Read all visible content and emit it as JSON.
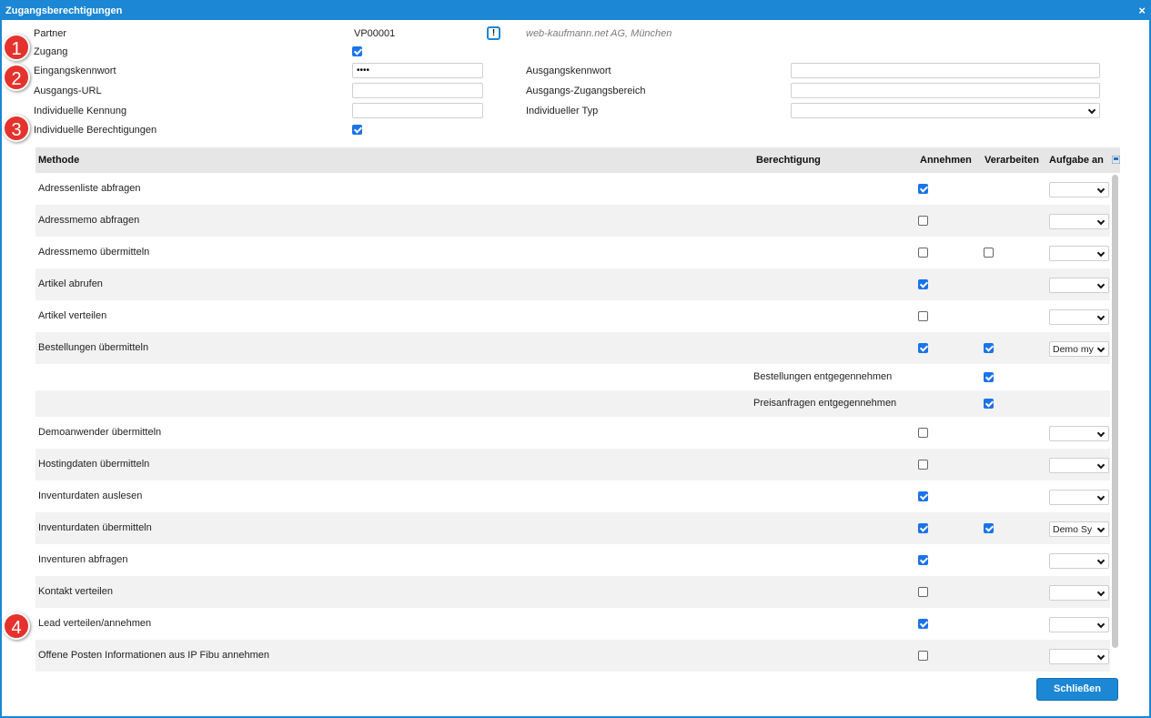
{
  "dialog": {
    "title": "Zugangsberechtigungen",
    "close_glyph": "×"
  },
  "form": {
    "partner_label": "Partner",
    "partner_value": "VP00001",
    "partner_info_glyph": "!",
    "partner_company": "web-kaufmann.net AG, München",
    "zugang_label": "Zugang",
    "zugang_checked": true,
    "eingangskennwort_label": "Eingangskennwort",
    "eingangskennwort_value": "••••",
    "ausgangskennwort_label": "Ausgangskennwort",
    "ausgangskennwort_value": "",
    "ausgangs_url_label": "Ausgangs-URL",
    "ausgangs_url_value": "",
    "ausgangs_zugangsbereich_label": "Ausgangs-Zugangsbereich",
    "ausgangs_zugangsbereich_value": "",
    "individuelle_kennung_label": "Individuelle Kennung",
    "individuelle_kennung_value": "",
    "individueller_typ_label": "Individueller Typ",
    "individueller_typ_value": "",
    "individuelle_berechtigungen_label": "Individuelle Berechtigungen",
    "individuelle_berechtigungen_checked": true
  },
  "markers": [
    "1",
    "2",
    "3",
    "4"
  ],
  "table": {
    "columns": {
      "methode": "Methode",
      "berechtigung": "Berechtigung",
      "annehmen": "Annehmen",
      "verarbeiten": "Verarbeiten",
      "aufgabe_an": "Aufgabe an"
    },
    "export_icon": "export-icon",
    "rows": [
      {
        "methode": "Adressenliste abfragen",
        "berechtigung": "",
        "annehmen": true,
        "verarbeiten": null,
        "aufgabe": ""
      },
      {
        "methode": "Adressmemo abfragen",
        "berechtigung": "",
        "annehmen": false,
        "verarbeiten": null,
        "aufgabe": ""
      },
      {
        "methode": "Adressmemo übermitteln",
        "berechtigung": "",
        "annehmen": false,
        "verarbeiten": false,
        "aufgabe": ""
      },
      {
        "methode": "Artikel abrufen",
        "berechtigung": "",
        "annehmen": true,
        "verarbeiten": null,
        "aufgabe": ""
      },
      {
        "methode": "Artikel verteilen",
        "berechtigung": "",
        "annehmen": false,
        "verarbeiten": null,
        "aufgabe": ""
      },
      {
        "methode": "Bestellungen übermitteln",
        "berechtigung": "",
        "annehmen": true,
        "verarbeiten": true,
        "aufgabe": "Demo my"
      },
      {
        "methode": "",
        "berechtigung": "Bestellungen entgegennehmen",
        "annehmen": null,
        "verarbeiten": true,
        "aufgabe": null,
        "sub": true
      },
      {
        "methode": "",
        "berechtigung": "Preisanfragen entgegennehmen",
        "annehmen": null,
        "verarbeiten": true,
        "aufgabe": null,
        "sub": true
      },
      {
        "methode": "Demoanwender übermitteln",
        "berechtigung": "",
        "annehmen": false,
        "verarbeiten": null,
        "aufgabe": ""
      },
      {
        "methode": "Hostingdaten übermitteln",
        "berechtigung": "",
        "annehmen": false,
        "verarbeiten": null,
        "aufgabe": ""
      },
      {
        "methode": "Inventurdaten auslesen",
        "berechtigung": "",
        "annehmen": true,
        "verarbeiten": null,
        "aufgabe": ""
      },
      {
        "methode": "Inventurdaten übermitteln",
        "berechtigung": "",
        "annehmen": true,
        "verarbeiten": true,
        "aufgabe": "Demo Sy"
      },
      {
        "methode": "Inventuren abfragen",
        "berechtigung": "",
        "annehmen": true,
        "verarbeiten": null,
        "aufgabe": ""
      },
      {
        "methode": "Kontakt verteilen",
        "berechtigung": "",
        "annehmen": false,
        "verarbeiten": null,
        "aufgabe": ""
      },
      {
        "methode": "Lead verteilen/annehmen",
        "berechtigung": "",
        "annehmen": true,
        "verarbeiten": null,
        "aufgabe": ""
      },
      {
        "methode": "Offene Posten Informationen aus IP Fibu annehmen",
        "berechtigung": "",
        "annehmen": false,
        "verarbeiten": null,
        "aufgabe": ""
      }
    ]
  },
  "footer": {
    "close_label": "Schließen"
  },
  "colors": {
    "accent": "#1c87d4",
    "marker": "#e5322d",
    "checkbox": "#1a73e8",
    "row_alt": "#f2f2f2",
    "header": "#e6e6e6"
  }
}
